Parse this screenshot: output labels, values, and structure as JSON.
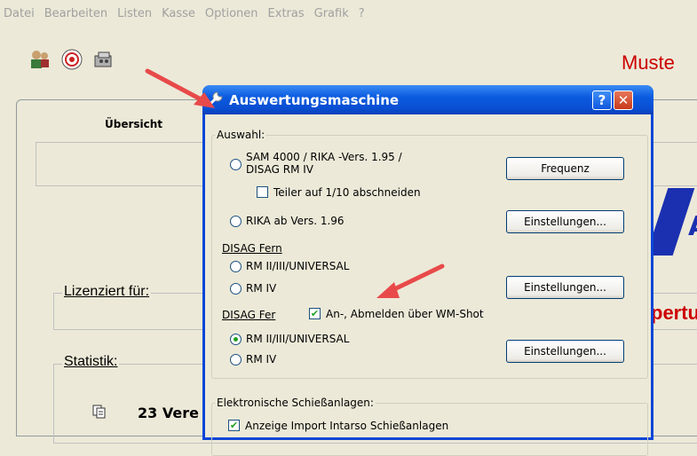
{
  "menubar": [
    "Datei",
    "Bearbeiten",
    "Listen",
    "Kasse",
    "Optionen",
    "Extras",
    "Grafik",
    "?"
  ],
  "background": {
    "brand": "Muste",
    "tab_uebersicht": "Übersicht",
    "lizenziert_label": "Lizenziert für:",
    "lizenziert_value": "pertu",
    "statistik_label": "Statistik:",
    "vereine": "23 Vere",
    "blue_fragment": "A"
  },
  "dialog": {
    "title": "Auswertungsmaschine",
    "help_label": "?",
    "close_label": "✕",
    "auswahl": {
      "label": "Auswahl:",
      "sam_option": "SAM 4000 / RIKA -Vers. 1.95 /",
      "sam_option_line2": "DISAG RM IV",
      "teiler_checkbox": "Teiler auf 1/10 abschneiden",
      "rika_option": "RIKA ab Vers. 1.96",
      "frequenz_button": "Frequenz",
      "einstellungen1_button": "Einstellungen..."
    },
    "disag_fern1": {
      "label": "DISAG Fern",
      "opt1": "RM II/III/UNIVERSAL",
      "opt2": "RM IV",
      "einstellungen_button": "Einstellungen..."
    },
    "disag_fern2": {
      "label": "DISAG Fer",
      "checkbox": "An-, Abmelden über WM-Shot",
      "opt1": "RM II/III/UNIVERSAL",
      "opt2": "RM IV",
      "einstellungen_button": "Einstellungen..."
    },
    "elektronische": {
      "label": "Elektronische Schießanlagen:",
      "checkbox": "Anzeige Import Intarso Schießanlagen"
    }
  },
  "colors": {
    "titlebar": "#0b5be0",
    "accent_red": "#cc0000",
    "arrow": "#e84a4a"
  }
}
